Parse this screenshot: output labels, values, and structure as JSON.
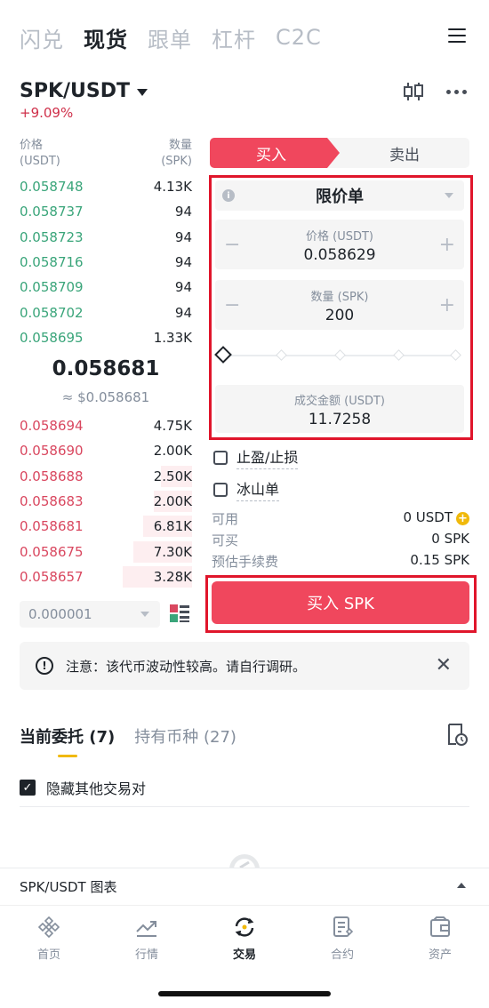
{
  "top_tabs": [
    "闪兑",
    "现货",
    "跟单",
    "杠杆",
    "C2C"
  ],
  "pair": {
    "symbol": "SPK/USDT",
    "change": "+9.09%"
  },
  "orderbook": {
    "price_header": "价格",
    "price_unit": "(USDT)",
    "qty_header": "数量",
    "qty_unit": "(SPK)",
    "asks": [
      {
        "price": "0.058748",
        "qty": "4.13K"
      },
      {
        "price": "0.058737",
        "qty": "94"
      },
      {
        "price": "0.058723",
        "qty": "94"
      },
      {
        "price": "0.058716",
        "qty": "94"
      },
      {
        "price": "0.058709",
        "qty": "94"
      },
      {
        "price": "0.058702",
        "qty": "94"
      },
      {
        "price": "0.058695",
        "qty": "1.33K"
      }
    ],
    "mid_price": "0.058681",
    "mid_usd": "≈ $0.058681",
    "bids": [
      {
        "price": "0.058694",
        "qty": "4.75K",
        "depth": 0
      },
      {
        "price": "0.058690",
        "qty": "2.00K",
        "depth": 0
      },
      {
        "price": "0.058688",
        "qty": "2.50K",
        "depth": 0.45
      },
      {
        "price": "0.058683",
        "qty": "2.00K",
        "depth": 0.55
      },
      {
        "price": "0.058681",
        "qty": "6.81K",
        "depth": 0.7
      },
      {
        "price": "0.058675",
        "qty": "7.30K",
        "depth": 0.85
      },
      {
        "price": "0.058657",
        "qty": "3.28K",
        "depth": 1.0
      }
    ],
    "depth_value": "0.000001"
  },
  "trade": {
    "buy_label": "买入",
    "sell_label": "卖出",
    "order_type": "限价单",
    "price_label": "价格 (USDT)",
    "price_value": "0.058629",
    "qty_label": "数量 (SPK)",
    "qty_value": "200",
    "total_label": "成交金额 (USDT)",
    "total_value": "11.7258",
    "tp_sl_label": "止盈/止损",
    "iceberg_label": "冰山单",
    "available_label": "可用",
    "available_value": "0 USDT",
    "can_buy_label": "可买",
    "can_buy_value": "0 SPK",
    "fee_label": "预估手续费",
    "fee_value": "0.15 SPK",
    "submit_label": "买入 SPK"
  },
  "notice": "注意：该代币波动性较高。请自行调研。",
  "orders": {
    "tab_open": "当前委托 (7)",
    "tab_holdings": "持有币种 (27)",
    "hide_others": "隐藏其他交易对"
  },
  "chart_bar": "SPK/USDT 图表",
  "nav": [
    "首页",
    "行情",
    "交易",
    "合约",
    "资产"
  ],
  "colors": {
    "buy": "#f0475d",
    "ask_green": "#3aa57a",
    "bid_red": "#d9475f",
    "accent": "#f0b90b"
  }
}
